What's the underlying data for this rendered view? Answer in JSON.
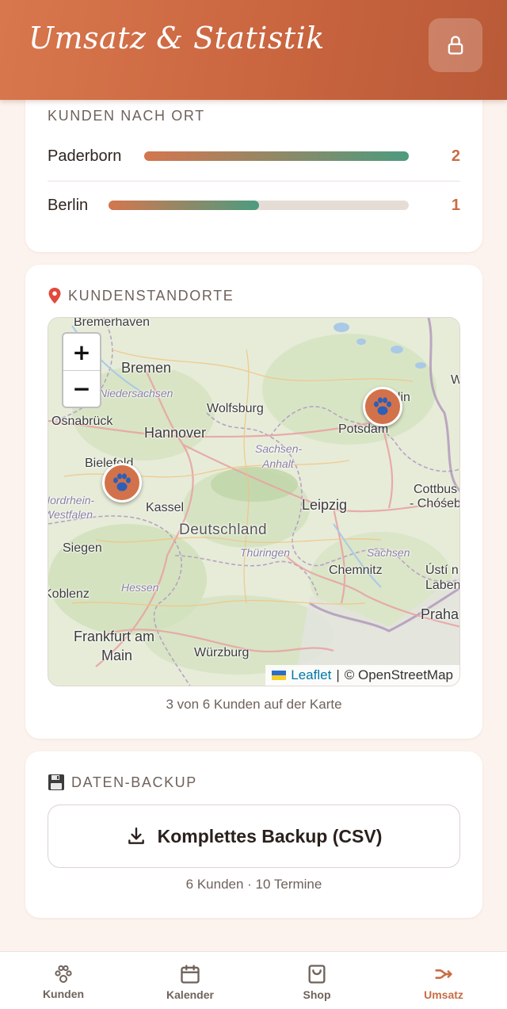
{
  "header": {
    "title": "Umsatz & Statistik",
    "lock_icon": "lock-icon"
  },
  "customers_by_city": {
    "label": "KUNDEN NACH ORT",
    "rows": [
      {
        "city": "Paderborn",
        "count": "2",
        "fraction": 1.0
      },
      {
        "city": "Berlin",
        "count": "1",
        "fraction": 0.5
      }
    ]
  },
  "locations": {
    "label": "KUNDENSTANDORTE",
    "icon": "pin-icon",
    "map": {
      "zoom_in": "+",
      "zoom_out": "−",
      "attribution_link": "Leaflet",
      "attribution_sep": "|",
      "attribution_text": "© OpenStreetMap",
      "places": {
        "bremerhaven": "Bremerhaven",
        "bremen": "Bremen",
        "niedersachsen": "Niedersachsen",
        "wolfsburg": "Wolfsburg",
        "osnabrueck": "Osnabrück",
        "hannover": "Hannover",
        "potsdam": "Potsdam",
        "bielefeld": "Bielefeld",
        "sachsen_anhalt_1": "Sachsen-",
        "sachsen_anhalt_2": "Anhalt",
        "nrw_1": "Nordrhein-",
        "nrw_2": "Westfalen",
        "kassel": "Kassel",
        "leipzig": "Leipzig",
        "cottbus_1": "Cottbus",
        "cottbus_2": "- Chóśebuz",
        "deutschland": "Deutschland",
        "thueringen": "Thüringen",
        "sachsen": "Sachsen",
        "siegen": "Siegen",
        "chemnitz": "Chemnitz",
        "usti_1": "Ústí n",
        "usti_2": "Laben",
        "koblenz": "Koblenz",
        "hessen": "Hessen",
        "praha": "Praha",
        "frankfurt_1": "Frankfurt am",
        "frankfurt_2": "Main",
        "wuerzburg": "Würzburg",
        "berlin": "Berlin",
        "w_edge": "W"
      }
    },
    "caption": "3 von 6 Kunden auf der Karte"
  },
  "backup": {
    "label": "DATEN-BACKUP",
    "icon": "floppy-disk-icon",
    "button_label": "Komplettes Backup (CSV)",
    "caption": "6 Kunden · 10 Termine"
  },
  "nav": {
    "items": [
      {
        "label": "Kunden",
        "icon": "paw-icon"
      },
      {
        "label": "Kalender",
        "icon": "calendar-icon"
      },
      {
        "label": "Shop",
        "icon": "shopping-bag-icon"
      },
      {
        "label": "Umsatz",
        "icon": "split-arrows-icon"
      }
    ],
    "active": "Umsatz"
  },
  "colors": {
    "header_start": "#d8774e",
    "header_end": "#b95a38",
    "accent": "#c96c44",
    "bar_start": "#d4764e",
    "bar_end": "#4d9b7f",
    "marker": "#d2724a"
  }
}
